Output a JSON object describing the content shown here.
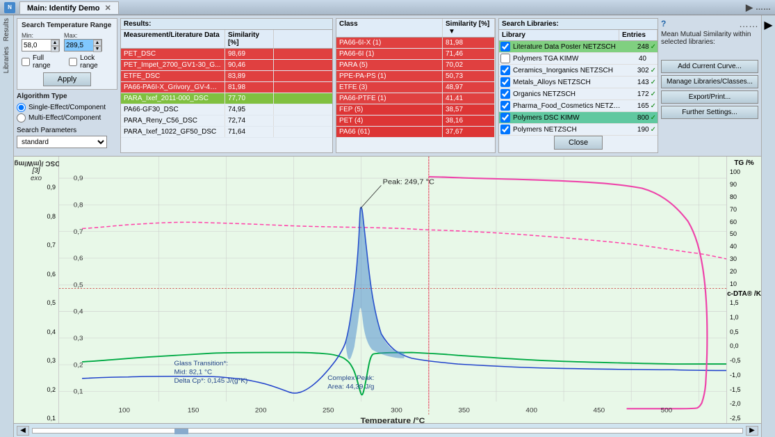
{
  "titleBar": {
    "appIcon": "N",
    "tabLabel": "Main: Identify Demo",
    "navArrow": "▶",
    "dotMenu": "……"
  },
  "leftSidebar": {
    "labels": [
      "Results",
      "Libraries"
    ]
  },
  "searchTemp": {
    "title": "Search Temperature Range",
    "minLabel": "Min:",
    "maxLabel": "Max:",
    "minValue": "58,0",
    "maxValue": "289,5",
    "fullRangeLabel": "Full range",
    "lockRangeLabel": "Lock range",
    "applyLabel": "Apply"
  },
  "algorithm": {
    "title": "Algorithm Type",
    "option1": "Single-Effect/Component",
    "option2": "Multi-Effect/Component",
    "searchParamsLabel": "Search Parameters",
    "searchParamsValue": "standard"
  },
  "results": {
    "title": "Results:",
    "headers": [
      "Measurement/Literature Data",
      "Similarity [%]"
    ],
    "rows": [
      {
        "name": "PET_DSC",
        "similarity": "98,69",
        "style": "red"
      },
      {
        "name": "PET_Impet_2700_GV1-30_G...",
        "similarity": "90,46",
        "style": "red"
      },
      {
        "name": "ETFE_DSC",
        "similarity": "83,89",
        "style": "red"
      },
      {
        "name": "PA66-PA6I-X_Grivory_GV-4H-...",
        "similarity": "81,98",
        "style": "red"
      },
      {
        "name": "PARA_Ixef_2011-000_DSC",
        "similarity": "77,70",
        "style": "green"
      },
      {
        "name": "PA66-GF30_DSC",
        "similarity": "74,95",
        "style": ""
      },
      {
        "name": "PARA_Reny_C56_DSC",
        "similarity": "72,74",
        "style": ""
      },
      {
        "name": "PARA_Ixef_1022_GF50_DSC",
        "similarity": "71,64",
        "style": ""
      }
    ]
  },
  "classResults": {
    "headers": [
      "Class",
      "Similarity [%]"
    ],
    "rows": [
      {
        "name": "PA66-6I-X (1)",
        "similarity": "81,98",
        "style": "red"
      },
      {
        "name": "PA66-6I (1)",
        "similarity": "71,46",
        "style": "red"
      },
      {
        "name": "PARA (5)",
        "similarity": "70,02",
        "style": "red"
      },
      {
        "name": "PPE-PA-PS (1)",
        "similarity": "50,73",
        "style": "red"
      },
      {
        "name": "ETFE (3)",
        "similarity": "48,97",
        "style": "red"
      },
      {
        "name": "PA66-PTFE (1)",
        "similarity": "41,41",
        "style": "red"
      },
      {
        "name": "FEP (5)",
        "similarity": "38,57",
        "style": "red"
      },
      {
        "name": "PET (4)",
        "similarity": "38,16",
        "style": "red"
      },
      {
        "name": "PA66 (61)",
        "similarity": "37,67",
        "style": "red"
      }
    ]
  },
  "libraries": {
    "title": "Search Libraries:",
    "headers": [
      "Library",
      "Entries"
    ],
    "rows": [
      {
        "name": "Literature Data Poster NETZSCH",
        "entries": "248",
        "checked": true,
        "style": "green"
      },
      {
        "name": "Polymers TGA KIMW",
        "entries": "40",
        "checked": false,
        "style": ""
      },
      {
        "name": "Ceramics_Inorganics NETZSCH",
        "entries": "302",
        "checked": true,
        "style": ""
      },
      {
        "name": "Metals_Alloys NETZSCH",
        "entries": "143",
        "checked": true,
        "style": ""
      },
      {
        "name": "Organics NETZSCH",
        "entries": "172",
        "checked": true,
        "style": ""
      },
      {
        "name": "Pharma_Food_Cosmetics NETZSCH",
        "entries": "165",
        "checked": true,
        "style": ""
      },
      {
        "name": "Polymers DSC KIMW",
        "entries": "800",
        "checked": true,
        "style": "teal"
      },
      {
        "name": "Polymers NETZSCH",
        "entries": "190",
        "checked": true,
        "style": ""
      }
    ]
  },
  "actionButtons": {
    "addCurrentCurve": "Add Current Curve...",
    "manageLibraries": "Manage Libraries/Classes...",
    "exportPrint": "Export/Print...",
    "furtherSettings": "Further Settings...",
    "close": "Close"
  },
  "meanSimilarity": {
    "text": "Mean Mutual Similarity within selected libraries:"
  },
  "chart": {
    "yLeftLabel": "DSC /(mW/mg)",
    "yLeftUnit": "[3]",
    "exoLabel": "exo",
    "yRightLabel1": "TG /%",
    "yRightLabel2": "c-DTA® /K",
    "xLabel": "Temperature /°C",
    "peakLabel": "Peak: 249,7 °C",
    "glassTransitionLabel": "Glass Transition*:",
    "gtMid": "Mid: 82,1 °C",
    "gtDelta": "Delta Cp*: 0,145 J/(g*K)",
    "complexPeakLabel": "Complex Peak:",
    "complexPeakArea": "Area: 44,39 J/g",
    "yLeftValues": [
      "0,9",
      "0,8",
      "0,7",
      "0,6",
      "0,5",
      "0,4",
      "0,3",
      "0,2",
      "0,1"
    ],
    "yRightTG": [
      "100",
      "90",
      "80",
      "70",
      "60",
      "50",
      "40",
      "30",
      "20",
      "10"
    ],
    "yRightCDTA": [
      "1,5",
      "1,0",
      "0,5",
      "0,0",
      "-0,5",
      "-1,0",
      "-1,5",
      "-2,0",
      "-2,5"
    ],
    "xValues": [
      "100",
      "150",
      "200",
      "250",
      "300",
      "350",
      "400",
      "450",
      "500"
    ]
  }
}
